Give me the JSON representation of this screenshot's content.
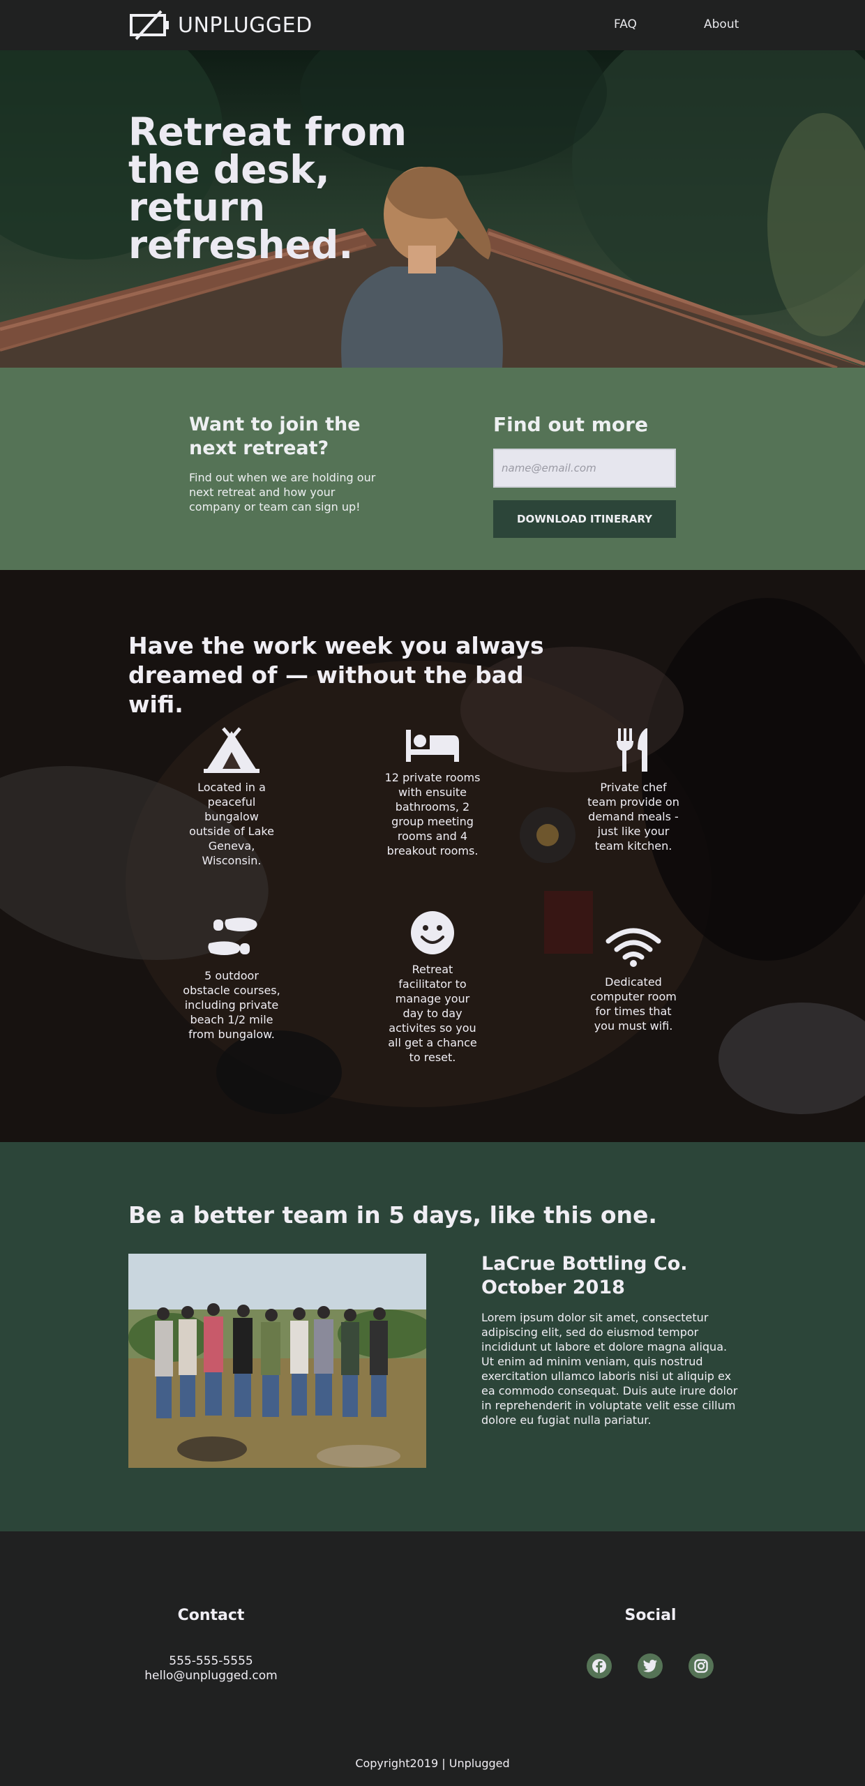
{
  "nav": {
    "brand": "UNPLUGGED",
    "links": [
      {
        "label": "FAQ"
      },
      {
        "label": "About"
      }
    ]
  },
  "hero": {
    "title": "Retreat from the desk, return refreshed."
  },
  "signup": {
    "heading": "Want to join the next retreat?",
    "text": "Find out when we are holding our next retreat and how your company or team can sign up!",
    "find_heading": "Find out more",
    "email_placeholder": "name@email.com",
    "button_label": "DOWNLOAD ITINERARY"
  },
  "features": {
    "title": "Have the work week you always dreamed of — without the bad wifi.",
    "items": [
      {
        "icon": "campground-icon",
        "text": "Located in a peaceful bungalow outside of Lake Geneva, Wisconsin."
      },
      {
        "icon": "bed-icon",
        "text": "12 private rooms with ensuite bathrooms, 2 group meeting rooms and 4 breakout rooms."
      },
      {
        "icon": "utensils-icon",
        "text": "Private chef team provide on demand meals - just like your team kitchen."
      },
      {
        "icon": "footprints-icon",
        "text": "5 outdoor obstacle courses, including private beach 1/2 mile from bungalow."
      },
      {
        "icon": "smile-icon",
        "text": "Retreat facilitator to manage your day to day activites so you all get a chance to reset."
      },
      {
        "icon": "wifi-icon",
        "text": "Dedicated computer room for times that you must wifi."
      }
    ]
  },
  "team": {
    "title": "Be a better team in 5 days, like this one.",
    "company": "LaCrue Bottling Co. October 2018",
    "body": "Lorem ipsum dolor sit amet, consectetur adipiscing elit, sed do eiusmod tempor incididunt ut labore et dolore magna aliqua. Ut enim ad minim veniam, quis nostrud exercitation ullamco laboris nisi ut aliquip ex ea commodo consequat. Duis aute irure dolor in reprehenderit in voluptate velit esse cillum dolore eu fugiat nulla pariatur."
  },
  "footer": {
    "contact_heading": "Contact",
    "phone": "555-555-5555",
    "email": "hello@unplugged.com",
    "social_heading": "Social",
    "social_icons": [
      "facebook-icon",
      "twitter-icon",
      "instagram-icon"
    ],
    "copyright": "Copyright2019 | Unplugged"
  },
  "colors": {
    "nav_bg": "#202121",
    "signup_bg": "#557356",
    "button_bg": "#2c4539",
    "team_bg": "#2c4539",
    "footer_bg": "#202121",
    "social_bg": "#557356"
  }
}
